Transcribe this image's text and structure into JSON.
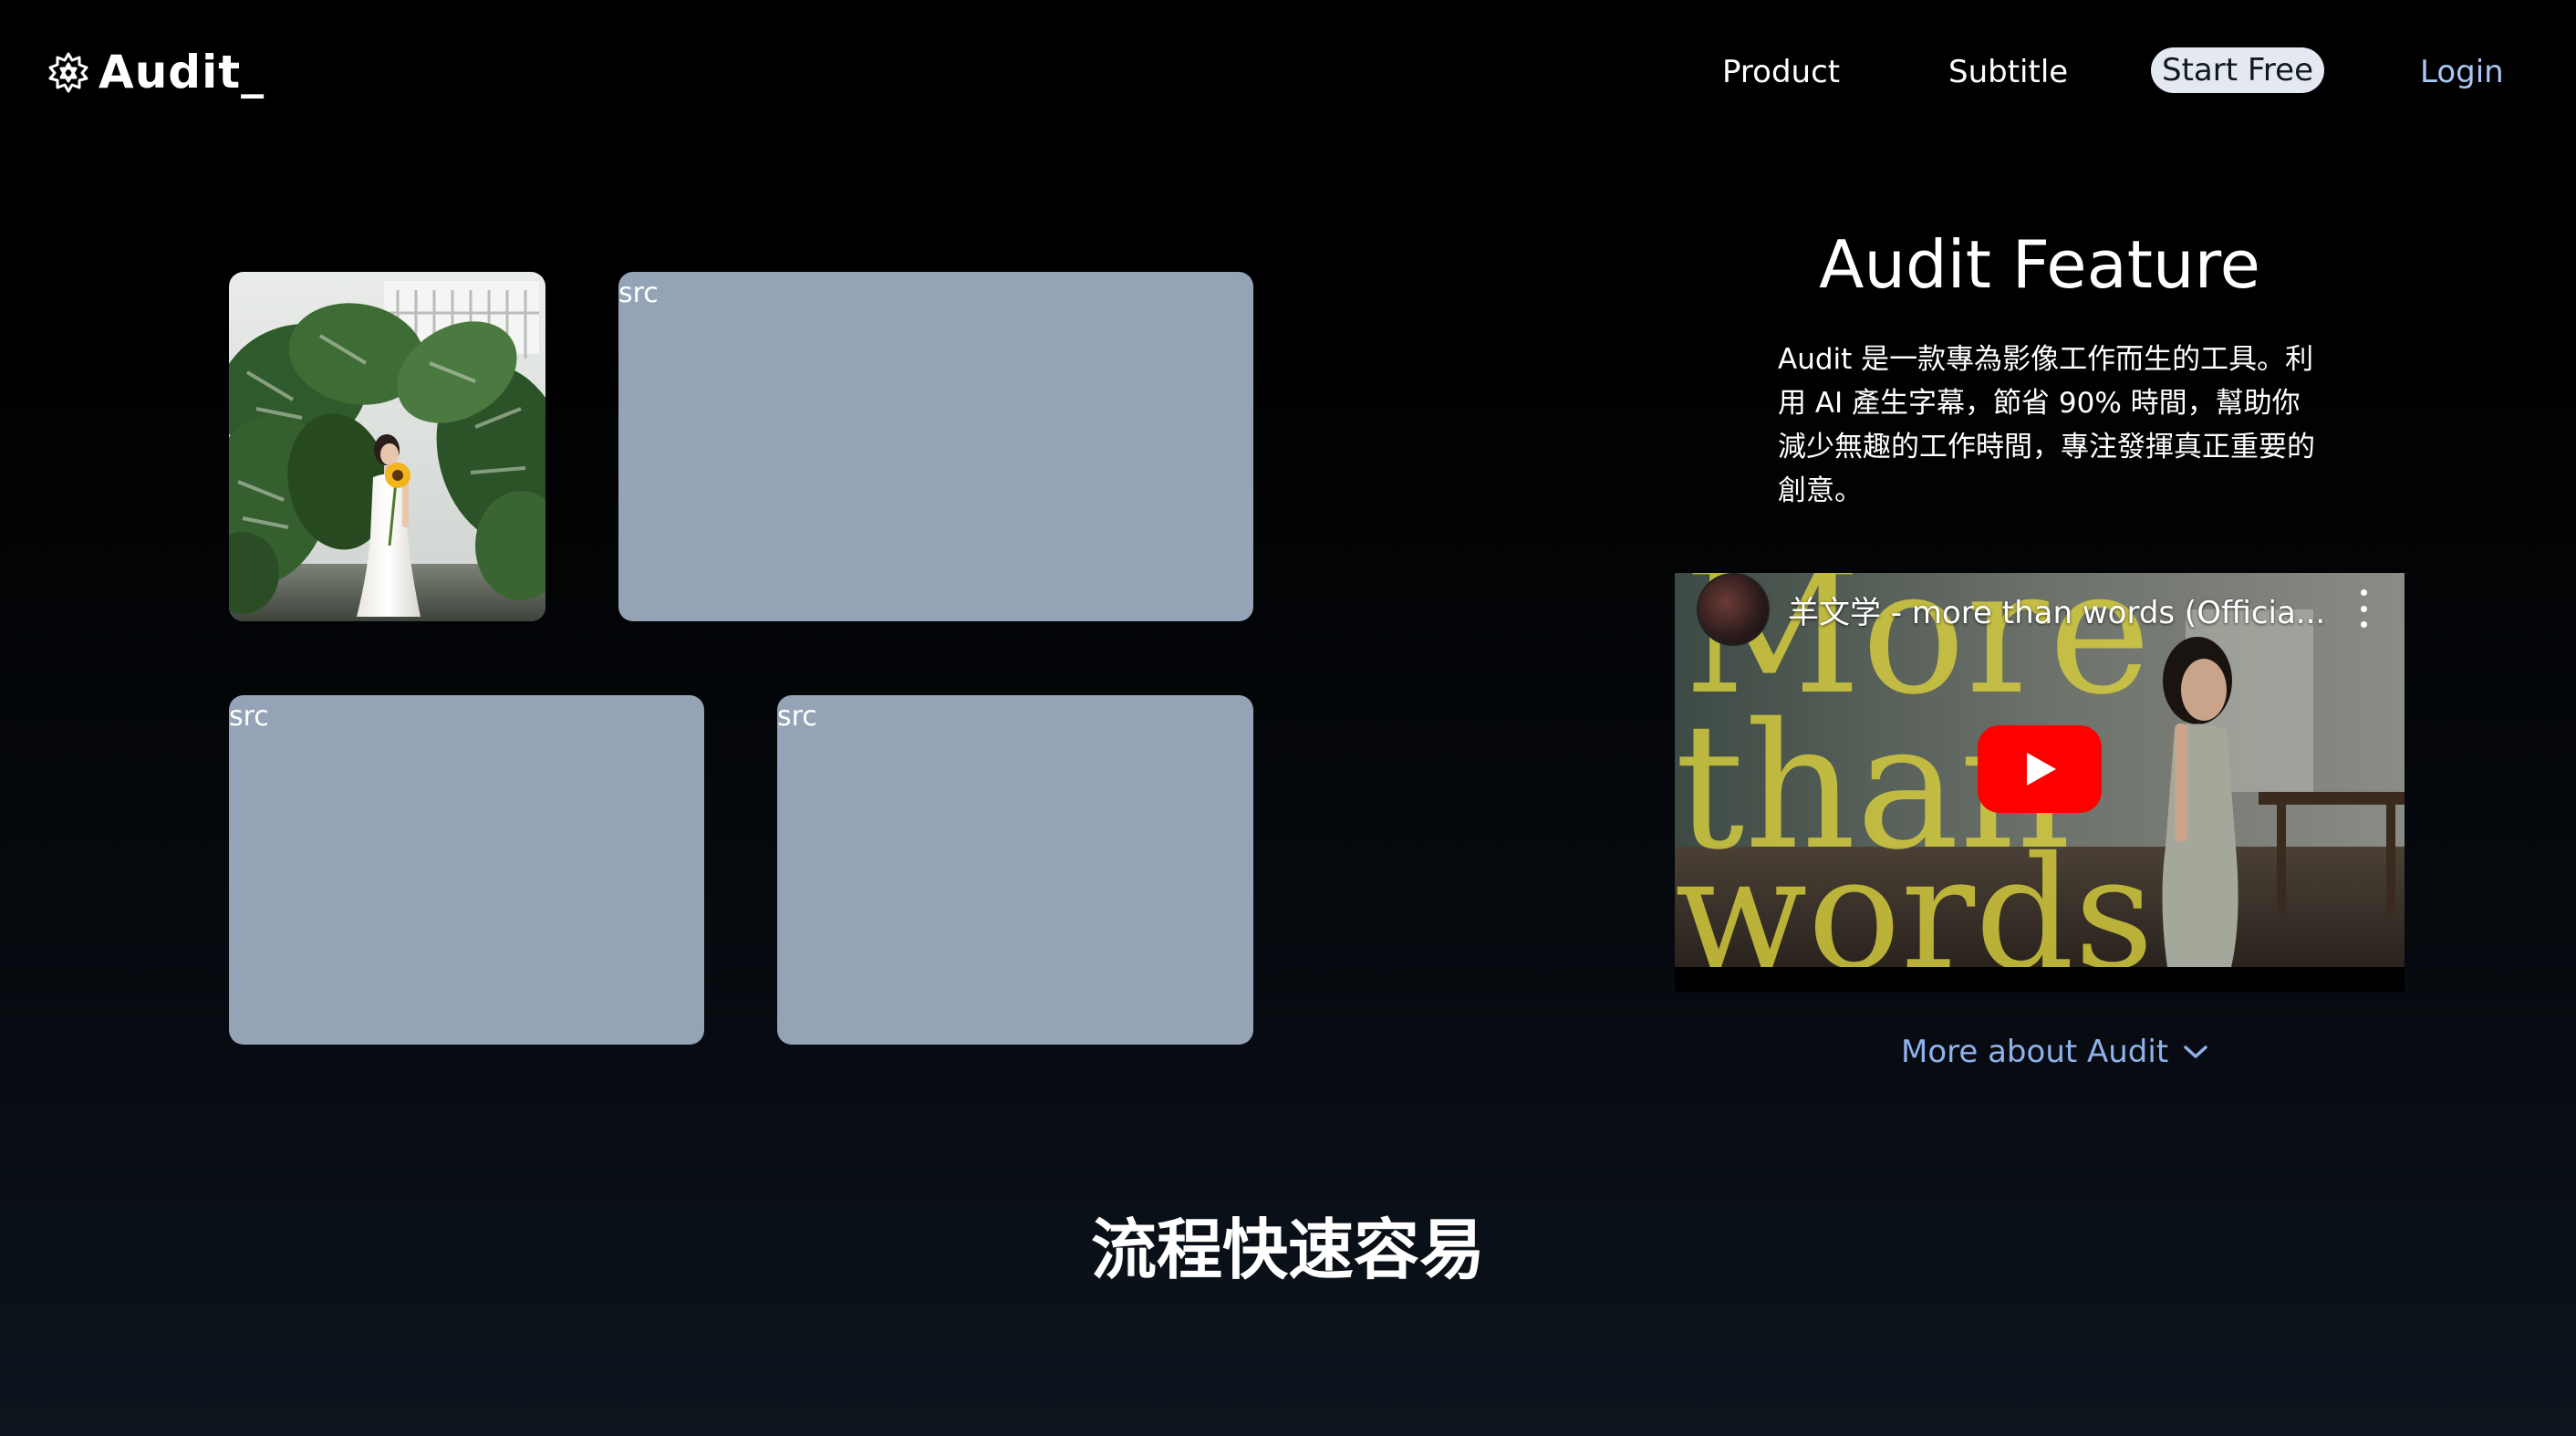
{
  "header": {
    "logo_text": "Audit_",
    "logo_icon": "gear-star-icon",
    "nav": {
      "product": "Product",
      "subtitle": "Subtitle",
      "start_free": "Start Free",
      "login": "Login"
    }
  },
  "gallery": {
    "photo_icon": "woman-with-sunflower-photo",
    "placeholders": [
      {
        "label": "src"
      },
      {
        "label": "src"
      },
      {
        "label": "src"
      }
    ]
  },
  "feature": {
    "title": "Audit Feature",
    "description": "Audit 是一款專為影像工作而生的工具。利用 AI 產生字幕，節省 90% 時間，幫助你減少無趣的工作時間，專注發揮真正重要的創意。"
  },
  "video": {
    "title": "羊文学 - more than words (Officia...",
    "overlay_text": "More than words",
    "play_icon": "play-icon",
    "menu_icon": "more-vertical-icon"
  },
  "more_link": {
    "label": "More about Audit",
    "icon": "chevron-down-icon"
  },
  "section": {
    "heading": "流程快速容易"
  },
  "colors": {
    "start_free_bg": "#e4e9f1",
    "link_blue": "#8fb2ec",
    "placeholder": "#95a3b7",
    "youtube_red": "#ff0000"
  }
}
